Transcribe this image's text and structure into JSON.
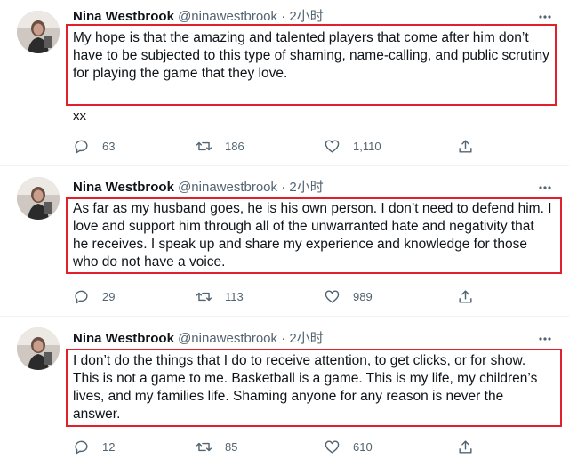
{
  "tweets": [
    {
      "author": "Nina Westbrook",
      "handle": "@ninawestbrook",
      "dot": "·",
      "time": "2小时",
      "text": "My hope is that the amazing and talented players that come after him don’t have to be subjected to this type of shaming, name-calling, and public scrutiny for playing the game that they love.",
      "extra": "xx",
      "replies": "63",
      "retweets": "186",
      "likes": "1,110"
    },
    {
      "author": "Nina Westbrook",
      "handle": "@ninawestbrook",
      "dot": "·",
      "time": "2小时",
      "text": "As far as my husband goes, he is his own person. I don’t need to defend him. I love and support him through all of the unwarranted hate and negativity that he receives. I speak up and share my experience and knowledge for those who do not have a voice.",
      "replies": "29",
      "retweets": "113",
      "likes": "989"
    },
    {
      "author": "Nina Westbrook",
      "handle": "@ninawestbrook",
      "dot": "·",
      "time": "2小时",
      "text": "I don’t do the things that I do to receive attention, to get clicks, or for show. This is not a game to me. Basketball is a game. This is my life, my children’s lives, and my families life. Shaming anyone for any reason is never the answer.",
      "replies": "12",
      "retweets": "85",
      "likes": "610"
    }
  ],
  "colors": {
    "text": "#0f1419",
    "secondary": "#536471",
    "highlight": "#e0202a",
    "divider": "#eff3f4"
  },
  "icons": {
    "reply": "reply-icon",
    "retweet": "retweet-icon",
    "like": "like-icon",
    "share": "share-icon",
    "more": "more-icon"
  }
}
